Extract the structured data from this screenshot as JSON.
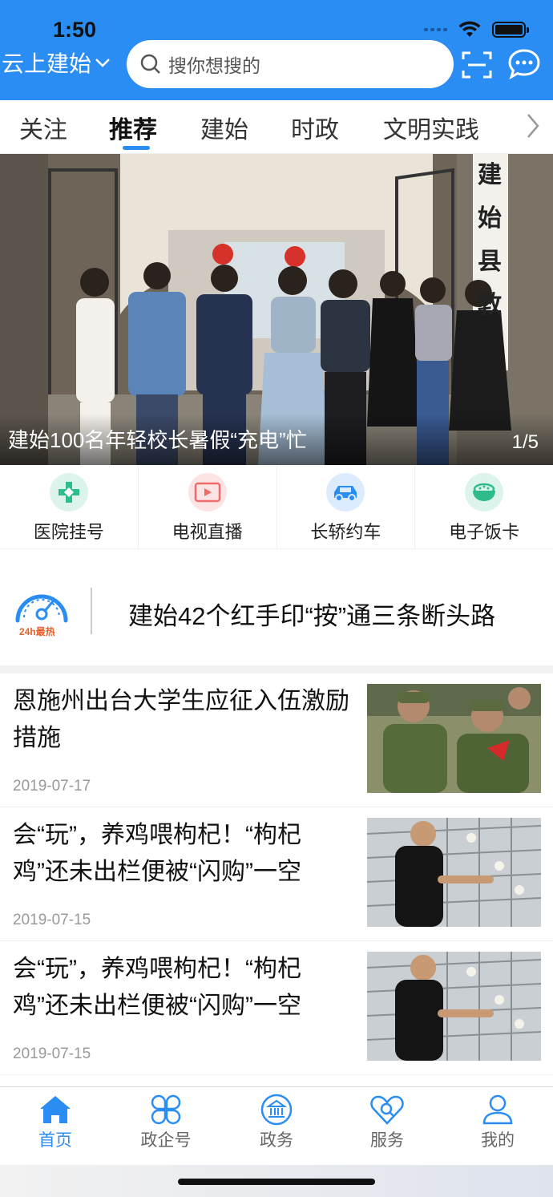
{
  "status_bar": {
    "time": "1:50"
  },
  "header": {
    "city": "云上建始",
    "search_placeholder": "搜你想搜的",
    "icons": [
      "chevron-down-icon",
      "search-icon",
      "scan-icon",
      "message-icon"
    ]
  },
  "tabs": [
    {
      "label": "关注",
      "active": false
    },
    {
      "label": "推荐",
      "active": true
    },
    {
      "label": "建始",
      "active": false
    },
    {
      "label": "时政",
      "active": false
    },
    {
      "label": "文明实践",
      "active": false
    }
  ],
  "banner": {
    "caption": "建始100名年轻校长暑假“充电”忙",
    "counter": "1/5",
    "sign_text": "建始县教"
  },
  "services": [
    {
      "label": "医院挂号",
      "icon": "hospital-icon",
      "color": "#2ebd8a"
    },
    {
      "label": "电视直播",
      "icon": "tv-live-icon",
      "color": "#f06a6a"
    },
    {
      "label": "长轿约车",
      "icon": "car-icon",
      "color": "#2a8df4"
    },
    {
      "label": "电子饭卡",
      "icon": "meal-card-icon",
      "color": "#2ebd8a"
    }
  ],
  "hot_news": {
    "badge": "24h最热",
    "title": "建始42个红手印“按”通三条断头路"
  },
  "news": [
    {
      "title": "恩施州出台大学生应征入伍激励措施",
      "date": "2019-07-17"
    },
    {
      "title": "会“玩”，养鸡喂枸杞！“枸杞鸡”还未出栏便被“闪购”一空",
      "date": "2019-07-15"
    },
    {
      "title": "会“玩”，养鸡喂枸杞！“枸杞鸡”还未出栏便被“闪购”一空",
      "date": "2019-07-15"
    }
  ],
  "bottom_nav": [
    {
      "label": "首页",
      "icon": "home-icon",
      "active": true
    },
    {
      "label": "政企号",
      "icon": "grid-icon",
      "active": false
    },
    {
      "label": "政务",
      "icon": "government-icon",
      "active": false
    },
    {
      "label": "服务",
      "icon": "service-heart-icon",
      "active": false
    },
    {
      "label": "我的",
      "icon": "user-icon",
      "active": false
    }
  ],
  "colors": {
    "brand": "#2a8df4",
    "hot_badge": "#e8612a"
  }
}
